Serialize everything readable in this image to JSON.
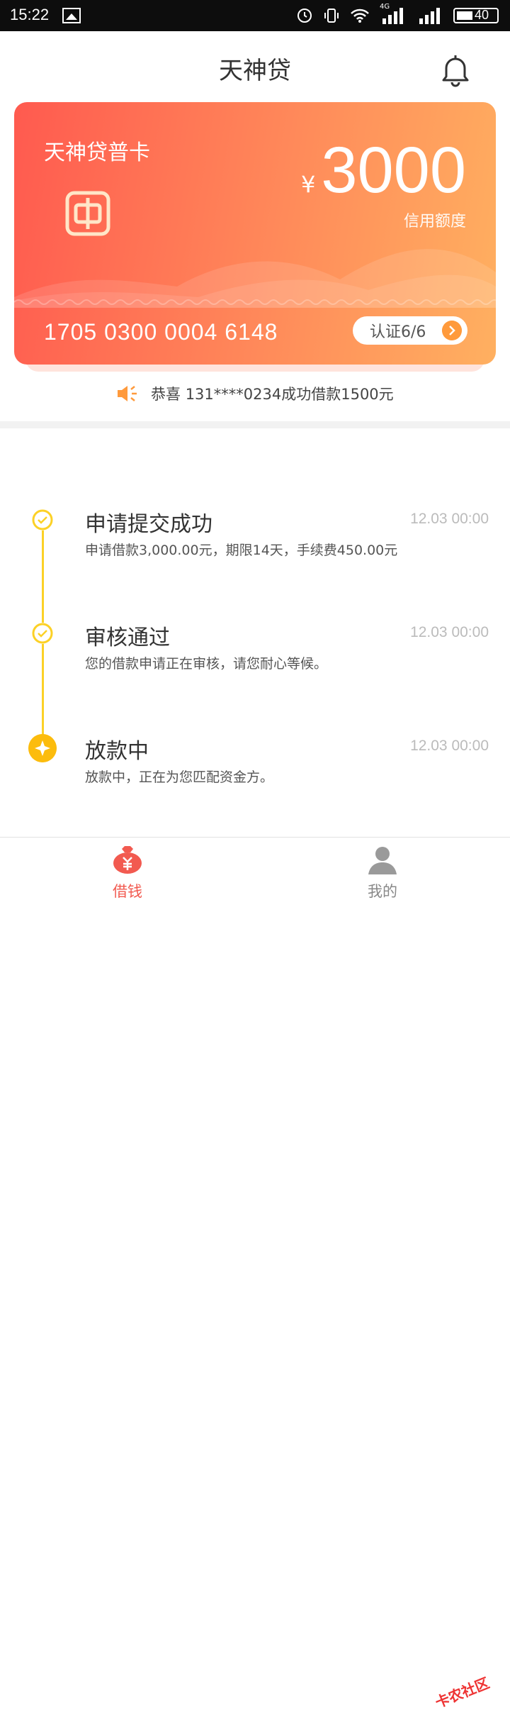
{
  "status_bar": {
    "time": "15:22",
    "battery": "40",
    "network": "4G"
  },
  "header": {
    "title": "天神贷"
  },
  "card": {
    "name": "天神贷普卡",
    "currency": "¥",
    "amount": "3000",
    "limit_label": "信用额度",
    "card_number": "1705 0300 0004 6148",
    "verify_label": "认证6/6"
  },
  "announcement": "恭喜 131****0234成功借款1500元",
  "timeline": [
    {
      "title": "申请提交成功",
      "time": "12.03 00:00",
      "desc": "申请借款3,000.00元，期限14天，手续费450.00元"
    },
    {
      "title": "审核通过",
      "time": "12.03 00:00",
      "desc": "您的借款申请正在审核，请您耐心等候。"
    },
    {
      "title": "放款中",
      "time": "12.03 00:00",
      "desc": "放款中，正在为您匹配资金方。"
    }
  ],
  "tabs": [
    {
      "label": "借钱",
      "active": true
    },
    {
      "label": "我的",
      "active": false
    }
  ],
  "watermark": "卡农社区",
  "colors": {
    "accent": "#fcd126",
    "card_start": "#ff5a4f",
    "card_end": "#ffb060",
    "tab_active": "#f25a50"
  }
}
